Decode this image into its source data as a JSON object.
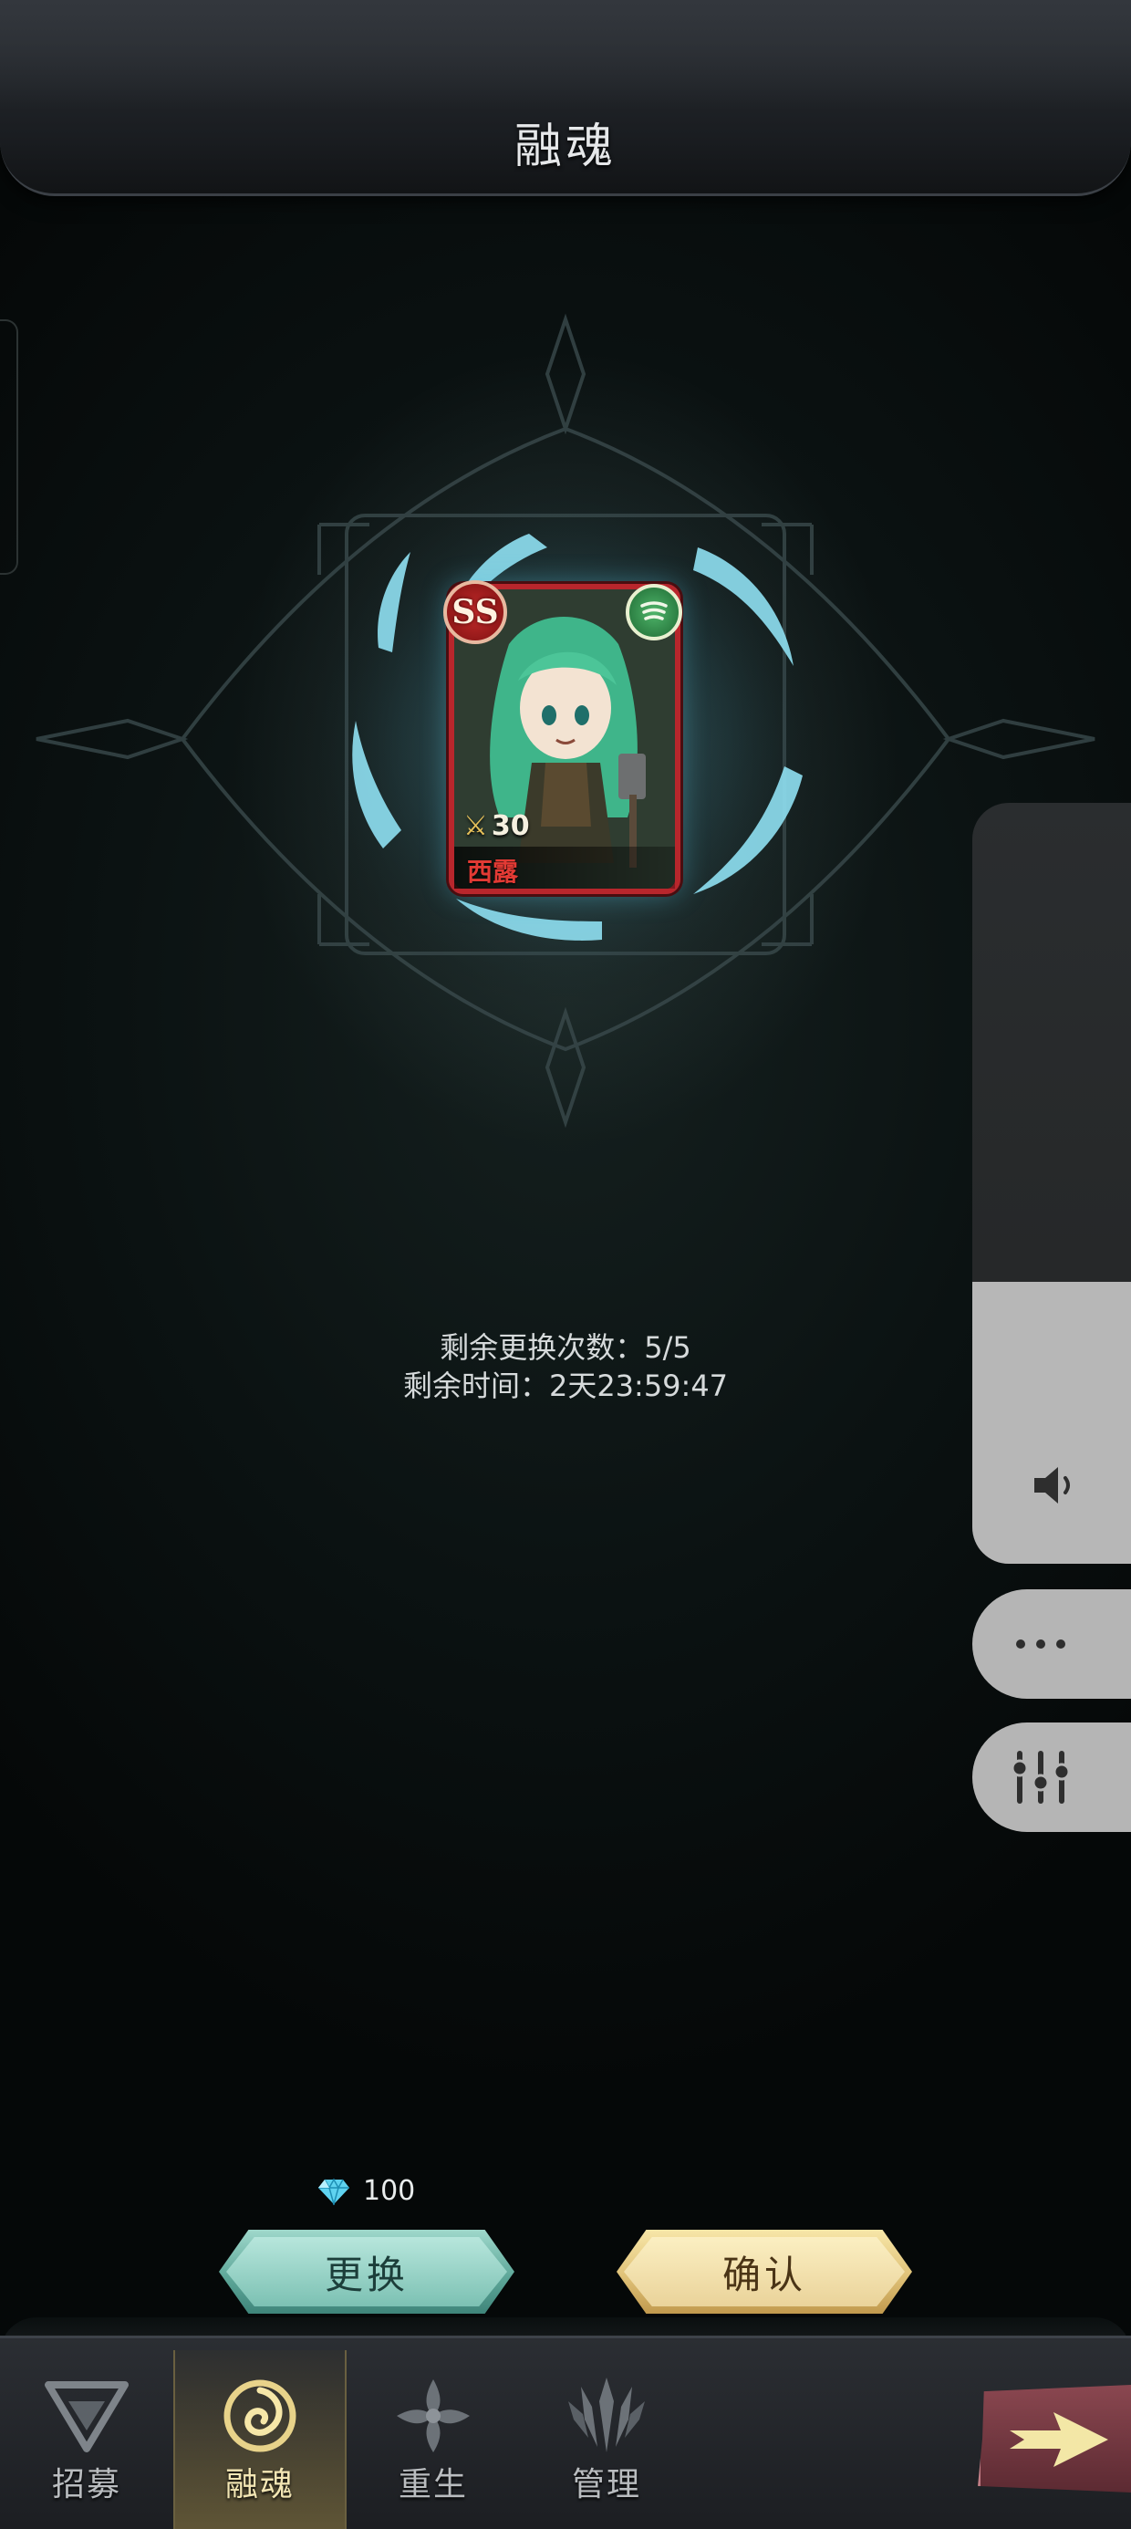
{
  "header": {
    "title": "融魂"
  },
  "hero_card": {
    "rank": "SS",
    "class_icon": "wind-class-icon",
    "level": "30",
    "name": "西露"
  },
  "info": {
    "remaining_swaps_label": "剩余更换次数：",
    "remaining_swaps_value": "5/5",
    "remaining_time_label": "剩余时间：",
    "remaining_time_value": "2天23:59:47"
  },
  "cost": {
    "icon": "diamond-icon",
    "amount": "100"
  },
  "actions": {
    "swap_label": "更换",
    "confirm_label": "确认"
  },
  "side_panel": {
    "volume_level": 0.37,
    "volume_icon": "speaker-icon",
    "more_icon": "ellipsis-icon",
    "settings_icon": "sliders-icon"
  },
  "nav": {
    "items": [
      {
        "label": "招募",
        "icon": "recruit-icon",
        "active": false
      },
      {
        "label": "融魂",
        "icon": "fuse-soul-icon",
        "active": true
      },
      {
        "label": "重生",
        "icon": "rebirth-icon",
        "active": false
      },
      {
        "label": "管理",
        "icon": "manage-icon",
        "active": false
      }
    ],
    "next_icon": "arrow-right-icon"
  },
  "colors": {
    "card_border": "#b8262c",
    "swap_button": "#6fb5a6",
    "confirm_button": "#e3c47c",
    "vortex_glow": "#7fd6ee"
  }
}
